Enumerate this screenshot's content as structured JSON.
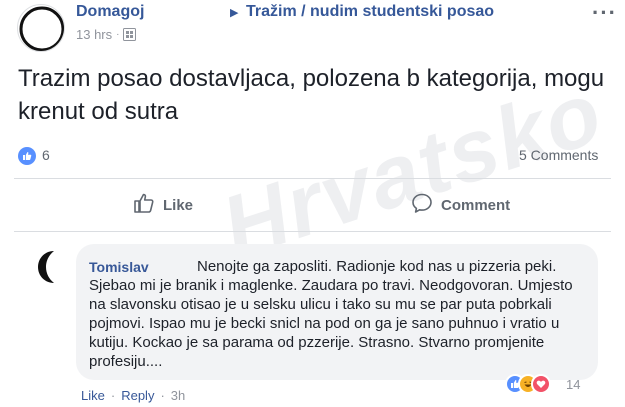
{
  "post": {
    "author": "Domagoj",
    "group_arrow": "▶",
    "group": "Tražim / nudim studentski posao",
    "time": "13 hrs",
    "dot": "·",
    "more": "···",
    "text": "Trazim posao dostavljaca, polozena b kategorija, mogu krenut od sutra",
    "reaction_count": "6",
    "comments_count": "5 Comments"
  },
  "actions": {
    "like": "Like",
    "comment": "Comment"
  },
  "comment": {
    "author": "Tomislav",
    "text": "Nenojte ga zaposliti. Radionje kod nas u pizzeria peki. Sjebao mi je branik i maglenke. Zaudara po travi. Neodgovoran. Umjesto na slavonsku otisao je u selsku ulicu i tako su mu se par puta pobrkali pojmovi. Ispao mu je becki snicl na pod on ga je sano puhnuo i vratio u kutiju. Kockao je sa parama od pzzerije. Strasno. Stvarno promjenite profesiju....",
    "reaction_count": "14",
    "like": "Like",
    "reply": "Reply",
    "sep": "·",
    "time": "3h"
  },
  "watermark": "Hrvatsko",
  "colors": {
    "link": "#365899",
    "meta": "#90949c",
    "like_blue": "#5890ff",
    "bubble": "#f2f3f5"
  },
  "icons": [
    "globe-icon",
    "more-icon",
    "like-reaction-icon",
    "thumbs-up-icon",
    "comment-icon",
    "haha-reaction-icon",
    "love-reaction-icon"
  ]
}
